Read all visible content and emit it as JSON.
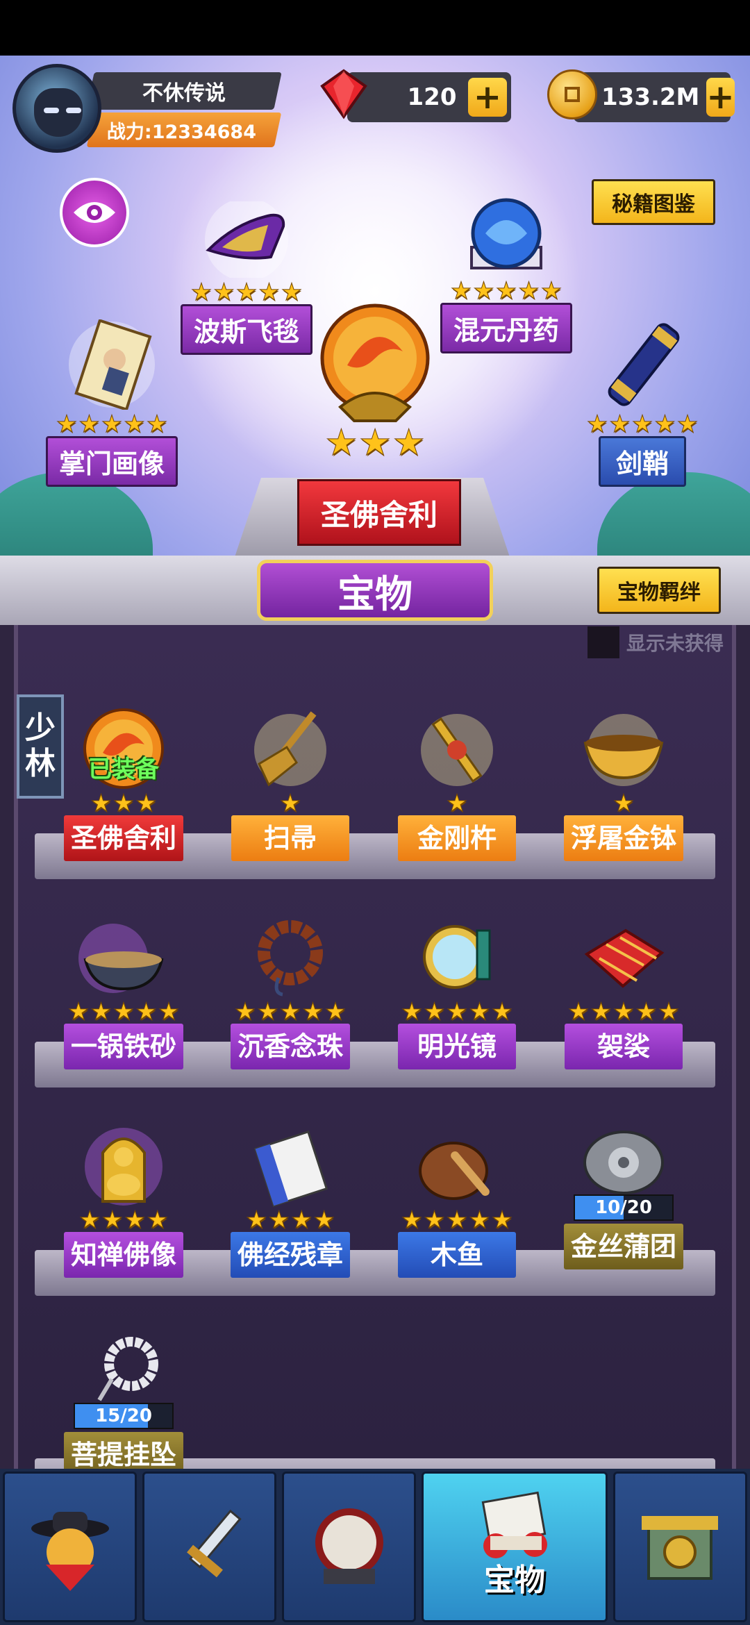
{
  "player": {
    "name": "不休传说",
    "power_label": "战力:12334684"
  },
  "currency": {
    "gems": "120",
    "coins": "133.2M"
  },
  "buttons": {
    "codex": "秘籍图鉴",
    "bond": "宝物羁绊"
  },
  "showcase": {
    "top_left": {
      "name": "波斯飞毯",
      "stars": 5
    },
    "top_right": {
      "name": "混元丹药",
      "stars": 5
    },
    "mid_left": {
      "name": "掌门画像",
      "stars": 5
    },
    "mid_right": {
      "name": "剑鞘",
      "stars": 5
    },
    "center": {
      "name": "圣佛舍利",
      "stars": 3
    }
  },
  "section_title": "宝物",
  "toggle_label": "显示未获得",
  "sect_tab": [
    "少",
    "林"
  ],
  "equipped_label": "已装备",
  "items": [
    {
      "name": "圣佛舍利",
      "stars": 3,
      "color": "red"
    },
    {
      "name": "扫帚",
      "stars": 1,
      "color": "orange"
    },
    {
      "name": "金刚杵",
      "stars": 1,
      "color": "orange"
    },
    {
      "name": "浮屠金钵",
      "stars": 1,
      "color": "orange"
    },
    {
      "name": "一锅铁砂",
      "stars": 5,
      "color": "purple"
    },
    {
      "name": "沉香念珠",
      "stars": 5,
      "color": "purple"
    },
    {
      "name": "明光镜",
      "stars": 5,
      "color": "purple"
    },
    {
      "name": "袈裟",
      "stars": 5,
      "color": "purple"
    },
    {
      "name": "知禅佛像",
      "stars": 4,
      "color": "purple"
    },
    {
      "name": "佛经残章",
      "stars": 4,
      "color": "blue"
    },
    {
      "name": "木鱼",
      "stars": 5,
      "color": "blue"
    },
    {
      "name": "金丝蒲团",
      "progress": "10/20",
      "color": "olive"
    },
    {
      "name": "菩提挂坠",
      "progress": "15/20",
      "color": "olive"
    }
  ],
  "nav": {
    "active_label": "宝物"
  },
  "colors": {
    "accent_yellow": "#f3b51b",
    "purple": "#7a26ae",
    "red": "#b01418"
  }
}
